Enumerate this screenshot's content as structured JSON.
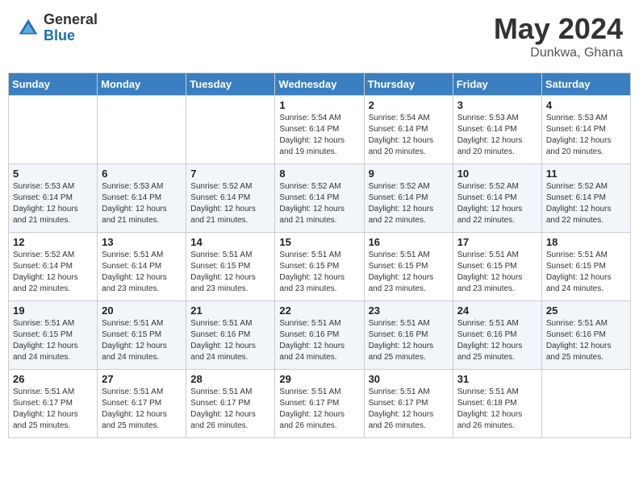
{
  "header": {
    "logo": {
      "general": "General",
      "blue": "Blue"
    },
    "title": "May 2024",
    "location": "Dunkwa, Ghana"
  },
  "calendar": {
    "weekdays": [
      "Sunday",
      "Monday",
      "Tuesday",
      "Wednesday",
      "Thursday",
      "Friday",
      "Saturday"
    ],
    "weeks": [
      [
        {
          "day": "",
          "info": ""
        },
        {
          "day": "",
          "info": ""
        },
        {
          "day": "",
          "info": ""
        },
        {
          "day": "1",
          "info": "Sunrise: 5:54 AM\nSunset: 6:14 PM\nDaylight: 12 hours\nand 19 minutes."
        },
        {
          "day": "2",
          "info": "Sunrise: 5:54 AM\nSunset: 6:14 PM\nDaylight: 12 hours\nand 20 minutes."
        },
        {
          "day": "3",
          "info": "Sunrise: 5:53 AM\nSunset: 6:14 PM\nDaylight: 12 hours\nand 20 minutes."
        },
        {
          "day": "4",
          "info": "Sunrise: 5:53 AM\nSunset: 6:14 PM\nDaylight: 12 hours\nand 20 minutes."
        }
      ],
      [
        {
          "day": "5",
          "info": "Sunrise: 5:53 AM\nSunset: 6:14 PM\nDaylight: 12 hours\nand 21 minutes."
        },
        {
          "day": "6",
          "info": "Sunrise: 5:53 AM\nSunset: 6:14 PM\nDaylight: 12 hours\nand 21 minutes."
        },
        {
          "day": "7",
          "info": "Sunrise: 5:52 AM\nSunset: 6:14 PM\nDaylight: 12 hours\nand 21 minutes."
        },
        {
          "day": "8",
          "info": "Sunrise: 5:52 AM\nSunset: 6:14 PM\nDaylight: 12 hours\nand 21 minutes."
        },
        {
          "day": "9",
          "info": "Sunrise: 5:52 AM\nSunset: 6:14 PM\nDaylight: 12 hours\nand 22 minutes."
        },
        {
          "day": "10",
          "info": "Sunrise: 5:52 AM\nSunset: 6:14 PM\nDaylight: 12 hours\nand 22 minutes."
        },
        {
          "day": "11",
          "info": "Sunrise: 5:52 AM\nSunset: 6:14 PM\nDaylight: 12 hours\nand 22 minutes."
        }
      ],
      [
        {
          "day": "12",
          "info": "Sunrise: 5:52 AM\nSunset: 6:14 PM\nDaylight: 12 hours\nand 22 minutes."
        },
        {
          "day": "13",
          "info": "Sunrise: 5:51 AM\nSunset: 6:14 PM\nDaylight: 12 hours\nand 23 minutes."
        },
        {
          "day": "14",
          "info": "Sunrise: 5:51 AM\nSunset: 6:15 PM\nDaylight: 12 hours\nand 23 minutes."
        },
        {
          "day": "15",
          "info": "Sunrise: 5:51 AM\nSunset: 6:15 PM\nDaylight: 12 hours\nand 23 minutes."
        },
        {
          "day": "16",
          "info": "Sunrise: 5:51 AM\nSunset: 6:15 PM\nDaylight: 12 hours\nand 23 minutes."
        },
        {
          "day": "17",
          "info": "Sunrise: 5:51 AM\nSunset: 6:15 PM\nDaylight: 12 hours\nand 23 minutes."
        },
        {
          "day": "18",
          "info": "Sunrise: 5:51 AM\nSunset: 6:15 PM\nDaylight: 12 hours\nand 24 minutes."
        }
      ],
      [
        {
          "day": "19",
          "info": "Sunrise: 5:51 AM\nSunset: 6:15 PM\nDaylight: 12 hours\nand 24 minutes."
        },
        {
          "day": "20",
          "info": "Sunrise: 5:51 AM\nSunset: 6:15 PM\nDaylight: 12 hours\nand 24 minutes."
        },
        {
          "day": "21",
          "info": "Sunrise: 5:51 AM\nSunset: 6:16 PM\nDaylight: 12 hours\nand 24 minutes."
        },
        {
          "day": "22",
          "info": "Sunrise: 5:51 AM\nSunset: 6:16 PM\nDaylight: 12 hours\nand 24 minutes."
        },
        {
          "day": "23",
          "info": "Sunrise: 5:51 AM\nSunset: 6:16 PM\nDaylight: 12 hours\nand 25 minutes."
        },
        {
          "day": "24",
          "info": "Sunrise: 5:51 AM\nSunset: 6:16 PM\nDaylight: 12 hours\nand 25 minutes."
        },
        {
          "day": "25",
          "info": "Sunrise: 5:51 AM\nSunset: 6:16 PM\nDaylight: 12 hours\nand 25 minutes."
        }
      ],
      [
        {
          "day": "26",
          "info": "Sunrise: 5:51 AM\nSunset: 6:17 PM\nDaylight: 12 hours\nand 25 minutes."
        },
        {
          "day": "27",
          "info": "Sunrise: 5:51 AM\nSunset: 6:17 PM\nDaylight: 12 hours\nand 25 minutes."
        },
        {
          "day": "28",
          "info": "Sunrise: 5:51 AM\nSunset: 6:17 PM\nDaylight: 12 hours\nand 26 minutes."
        },
        {
          "day": "29",
          "info": "Sunrise: 5:51 AM\nSunset: 6:17 PM\nDaylight: 12 hours\nand 26 minutes."
        },
        {
          "day": "30",
          "info": "Sunrise: 5:51 AM\nSunset: 6:17 PM\nDaylight: 12 hours\nand 26 minutes."
        },
        {
          "day": "31",
          "info": "Sunrise: 5:51 AM\nSunset: 6:18 PM\nDaylight: 12 hours\nand 26 minutes."
        },
        {
          "day": "",
          "info": ""
        }
      ]
    ]
  }
}
